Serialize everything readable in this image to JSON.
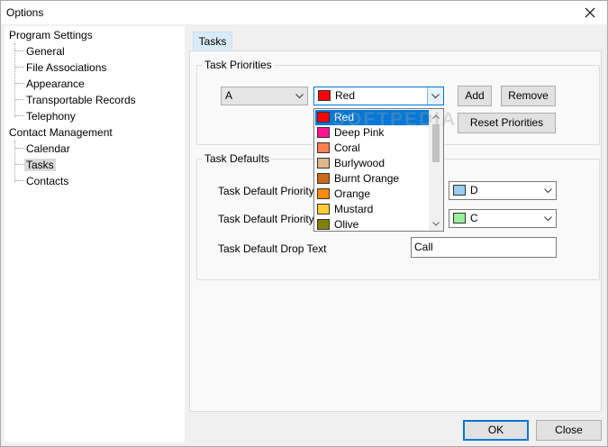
{
  "window": {
    "title": "Options"
  },
  "tree": {
    "program_settings": "Program Settings",
    "general": "General",
    "file_associations": "File Associations",
    "appearance": "Appearance",
    "transportable_records": "Transportable Records",
    "telephony": "Telephony",
    "contact_management": "Contact Management",
    "calendar": "Calendar",
    "tasks": "Tasks",
    "contacts": "Contacts"
  },
  "tab": {
    "label": "Tasks"
  },
  "priorities": {
    "group_title": "Task Priorities",
    "priority_value": "A",
    "color_value": "Red",
    "add_label": "Add",
    "remove_label": "Remove",
    "reset_label": "Reset Priorities"
  },
  "dropdown": {
    "items": [
      {
        "label": "Red",
        "color": "#ff0000"
      },
      {
        "label": "Deep Pink",
        "color": "#ff1493"
      },
      {
        "label": "Coral",
        "color": "#ff7f50"
      },
      {
        "label": "Burlywood",
        "color": "#deb887"
      },
      {
        "label": "Burnt Orange",
        "color": "#cc6a1a"
      },
      {
        "label": "Orange",
        "color": "#ff8c00"
      },
      {
        "label": "Mustard",
        "color": "#ffcc33"
      },
      {
        "label": "Olive",
        "color": "#808000"
      }
    ]
  },
  "defaults": {
    "group_title": "Task Defaults",
    "priority_label_1": "Task Default Priority",
    "priority_value_1": "D",
    "priority_color_1": "#99ccee",
    "priority_label_2": "Task Default Priority",
    "priority_value_2": "C",
    "priority_color_2": "#99ee99",
    "drop_text_label": "Task Default Drop Text",
    "drop_text_value": "Call"
  },
  "footer": {
    "ok_label": "OK",
    "close_label": "Close"
  },
  "watermark": "SOFTPEDIA"
}
